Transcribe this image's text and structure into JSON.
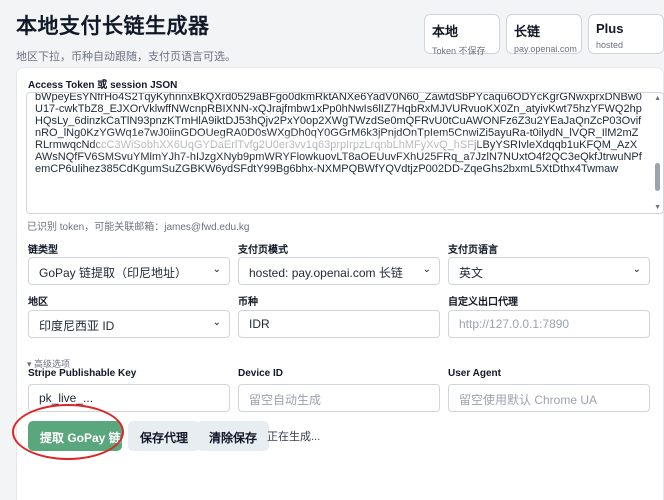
{
  "header": {
    "title": "本地支付长链生成器",
    "subtitle": "地区下拉，币种自动跟随，支付页语言可选。"
  },
  "badges": [
    {
      "title": "本地",
      "sub": "Token 不保存"
    },
    {
      "title": "长链",
      "sub": "pay.openai.com"
    },
    {
      "title": "Plus",
      "sub": "hosted"
    }
  ],
  "token": {
    "label": "Access Token 或 session JSON",
    "value": "bWpeyEsYNfrHo4S2TqyKyhnnxBkQXrd0529aBFgo0dkmRktANXe6YadV0N60_ZawtdSbPYcaqu6ODYcKgrGNwxprxDNBw0U17-cwkTbZ8_EJXOrVklwffNWcnpRBIXNN-xQJrajfmbw1xPp0hNwIs6lIZ7HqbRxMJVURvuoKX0Zn_atyivKwt75hzYFWQ2hpHQsLy_6dinzkCaTlN93pnzKTmHlA9iktDJ53hQjv2PxY0op2XWgTWzdSe0mQFRvU0tCuAWONFz6Z3u2YEaJaQnZcP03OvifnRO_lNg0KzYGWq1e7wJ0iinGDOUegRA0D0sWXgDh0qY0GGrM6k3jPnjdOnTpIem5CnwiZi5ayuRa-t0ilydN_lVQR_IlM2mZRLrmwqcNdccC3WiSobhXX6UqGYDaErlTvfg2U0er3vv1q63prpIrpzLrqnbLhMFyXvQ_hSFjLByYSRIvleXdqqb1uKFQM_AzXAWsNQfFV6SMSvuYMlmYJh7-hIJzgXNyb9pmWRYFlowkuovLT8aOEUuvFXhU25FRq_a7JzlN7NUxtO4f2QC3eQkfJtrwuNPfemCP6ulihez385CdKgumSuZGBKW6ydSFdtY99Bg6bhx-NXMPQBWfYQVdtjzP002DD-ZqeGhs2bxmL5XtDthx4Twmaw",
    "hint": "已识别 token，可能关联邮箱：james@fwd.edu.kg"
  },
  "form": {
    "chain_type": {
      "label": "链类型",
      "value": "GoPay 链提取（印尼地址）"
    },
    "pay_mode": {
      "label": "支付页模式",
      "value": "hosted: pay.openai.com 长链"
    },
    "pay_lang": {
      "label": "支付页语言",
      "value": "英文"
    },
    "region": {
      "label": "地区",
      "value": "印度尼西亚 ID"
    },
    "currency": {
      "label": "币种",
      "value": "IDR"
    },
    "proxy": {
      "label": "自定义出口代理",
      "placeholder": "http://127.0.0.1:7890"
    }
  },
  "advanced": {
    "toggle_label": "▾ 高级选项",
    "stripe_key": {
      "label": "Stripe Publishable Key",
      "value": "pk_live_..."
    },
    "device_id": {
      "label": "Device ID",
      "placeholder": "留空自动生成"
    },
    "user_agent": {
      "label": "User Agent",
      "placeholder": "留空使用默认 Chrome UA"
    }
  },
  "actions": {
    "extract_label": "提取 GoPay 链",
    "save_proxy_label": "保存代理",
    "clear_label": "清除保存",
    "status": "正在生成..."
  },
  "colors": {
    "primary_button": "#5aa77d",
    "highlight_ring": "#dc2626"
  }
}
